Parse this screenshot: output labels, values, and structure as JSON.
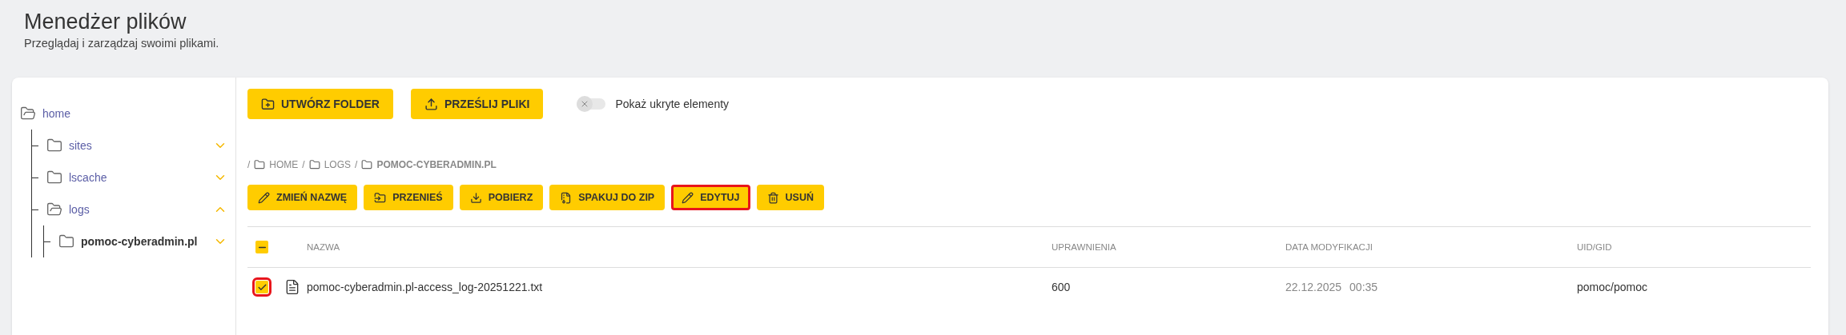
{
  "page": {
    "title": "Menedżer plików",
    "subtitle": "Przeglądaj i zarządzaj swoimi plikami."
  },
  "tree": [
    {
      "label": "home",
      "expanded": true,
      "selected": false,
      "children": [
        {
          "label": "sites",
          "expanded": false,
          "selected": false
        },
        {
          "label": "lscache",
          "expanded": false,
          "selected": false
        },
        {
          "label": "logs",
          "expanded": true,
          "selected": false,
          "children": [
            {
              "label": "pomoc-cyberadmin.pl",
              "expanded": false,
              "selected": true
            }
          ]
        }
      ]
    }
  ],
  "toolbar": {
    "buttons": [
      {
        "kind": "create-folder",
        "label": "UTWÓRZ FOLDER"
      },
      {
        "kind": "upload",
        "label": "PRZEŚLIJ PLIKI"
      }
    ],
    "toggle": {
      "label": "Pokaż ukryte elementy",
      "on": false
    }
  },
  "breadcrumb": [
    {
      "separator": "/",
      "label": "HOME",
      "current": false
    },
    {
      "separator": "/",
      "label": "LOGS",
      "current": false
    },
    {
      "separator": "/",
      "label": "POMOC-CYBERADMIN.PL",
      "current": true
    }
  ],
  "actions": [
    {
      "kind": "rename",
      "label": "ZMIEŃ NAZWĘ",
      "highlighted": false
    },
    {
      "kind": "move",
      "label": "PRZENIEŚ",
      "highlighted": false
    },
    {
      "kind": "download",
      "label": "POBIERZ",
      "highlighted": false
    },
    {
      "kind": "zip",
      "label": "SPAKUJ DO ZIP",
      "highlighted": false
    },
    {
      "kind": "edit",
      "label": "EDYTUJ",
      "highlighted": true
    },
    {
      "kind": "delete",
      "label": "USUŃ",
      "highlighted": false
    }
  ],
  "table": {
    "select_all": {
      "indeterminate": true
    },
    "columns": [
      "NAZWA",
      "UPRAWNIENIA",
      "DATA MODYFIKACJI",
      "UID/GID"
    ],
    "rows": [
      {
        "checked": true,
        "highlighted": true,
        "name": "pomoc-cyberadmin.pl-access_log-20251221.txt",
        "permissions": "600",
        "date": "22.12.2025",
        "time": "00:35",
        "owner": "pomoc/pomoc"
      }
    ]
  }
}
